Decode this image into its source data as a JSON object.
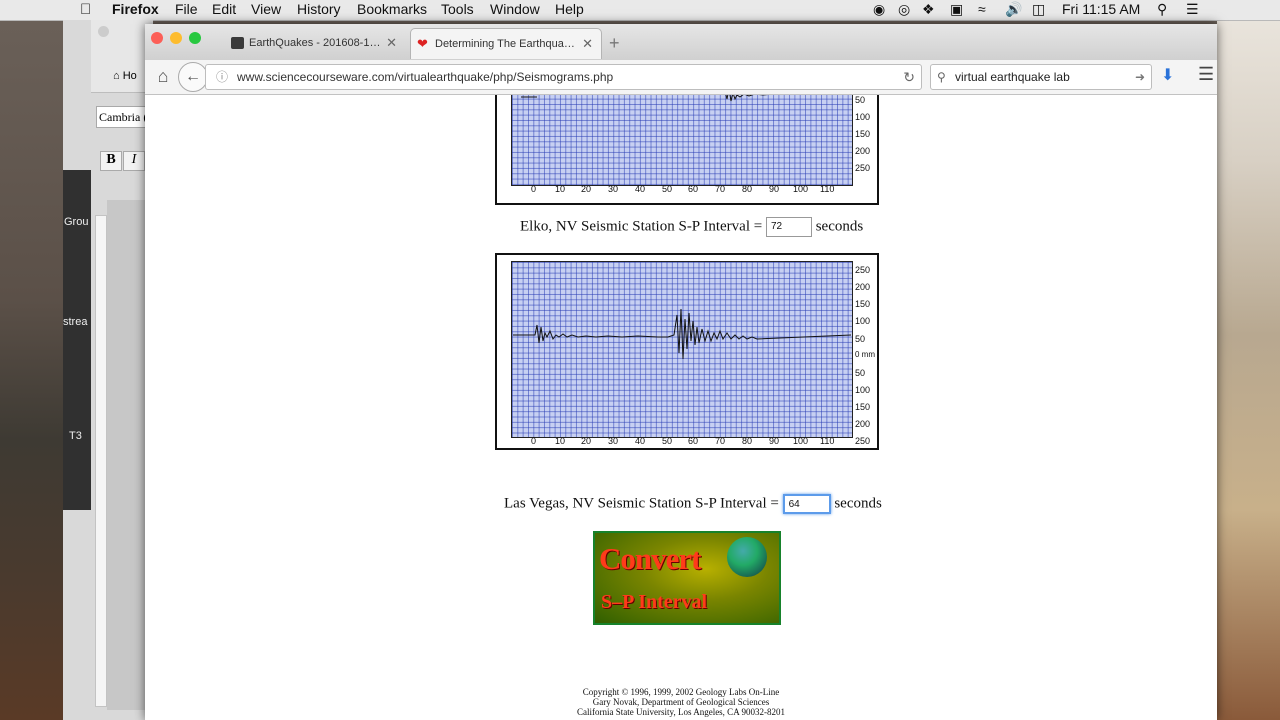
{
  "menubar": {
    "app": "Firefox",
    "menus": [
      "File",
      "Edit",
      "View",
      "History",
      "Bookmarks",
      "Tools",
      "Window",
      "Help"
    ],
    "clock": "Fri 11:15 AM"
  },
  "background_window": {
    "font_name": "Cambria (",
    "tab_label": "Ho",
    "bold_label": "B",
    "italic_label": "I",
    "dock_labels": [
      "Grou",
      "strea",
      "T3"
    ]
  },
  "browser": {
    "tabs": [
      {
        "label": "EarthQuakes - 201608-1…",
        "active": false
      },
      {
        "label": "Determining The Earthqua…",
        "active": true
      }
    ],
    "url": "www.sciencecourseware.com/virtualearthquake/php/Seismograms.php",
    "search_text": "virtual earthquake lab"
  },
  "page": {
    "stations": [
      {
        "label": "Elko, NV Seismic Station S-P Interval =",
        "value": "72",
        "unit": "seconds"
      },
      {
        "label": "Las Vegas, NV Seismic Station S-P Interval =",
        "value": "64",
        "unit": "seconds"
      }
    ],
    "x_ticks": [
      "0",
      "10",
      "20",
      "30",
      "40",
      "50",
      "60",
      "70",
      "80",
      "90",
      "100",
      "110"
    ],
    "y_ticks_top_partial": [
      "50",
      "100",
      "150",
      "200",
      "250"
    ],
    "y_ticks_full": [
      "250",
      "200",
      "150",
      "100",
      "50",
      "0 mm",
      "50",
      "100",
      "150",
      "200",
      "250"
    ],
    "convert_button": {
      "line1": "Convert",
      "line2": "S–P Interval"
    },
    "footer": [
      "Copyright © 1996, 1999, 2002 Geology Labs On-Line",
      "Gary Novak, Department of Geological Sciences",
      "California State University, Los Angeles, CA  90032-8201"
    ]
  }
}
